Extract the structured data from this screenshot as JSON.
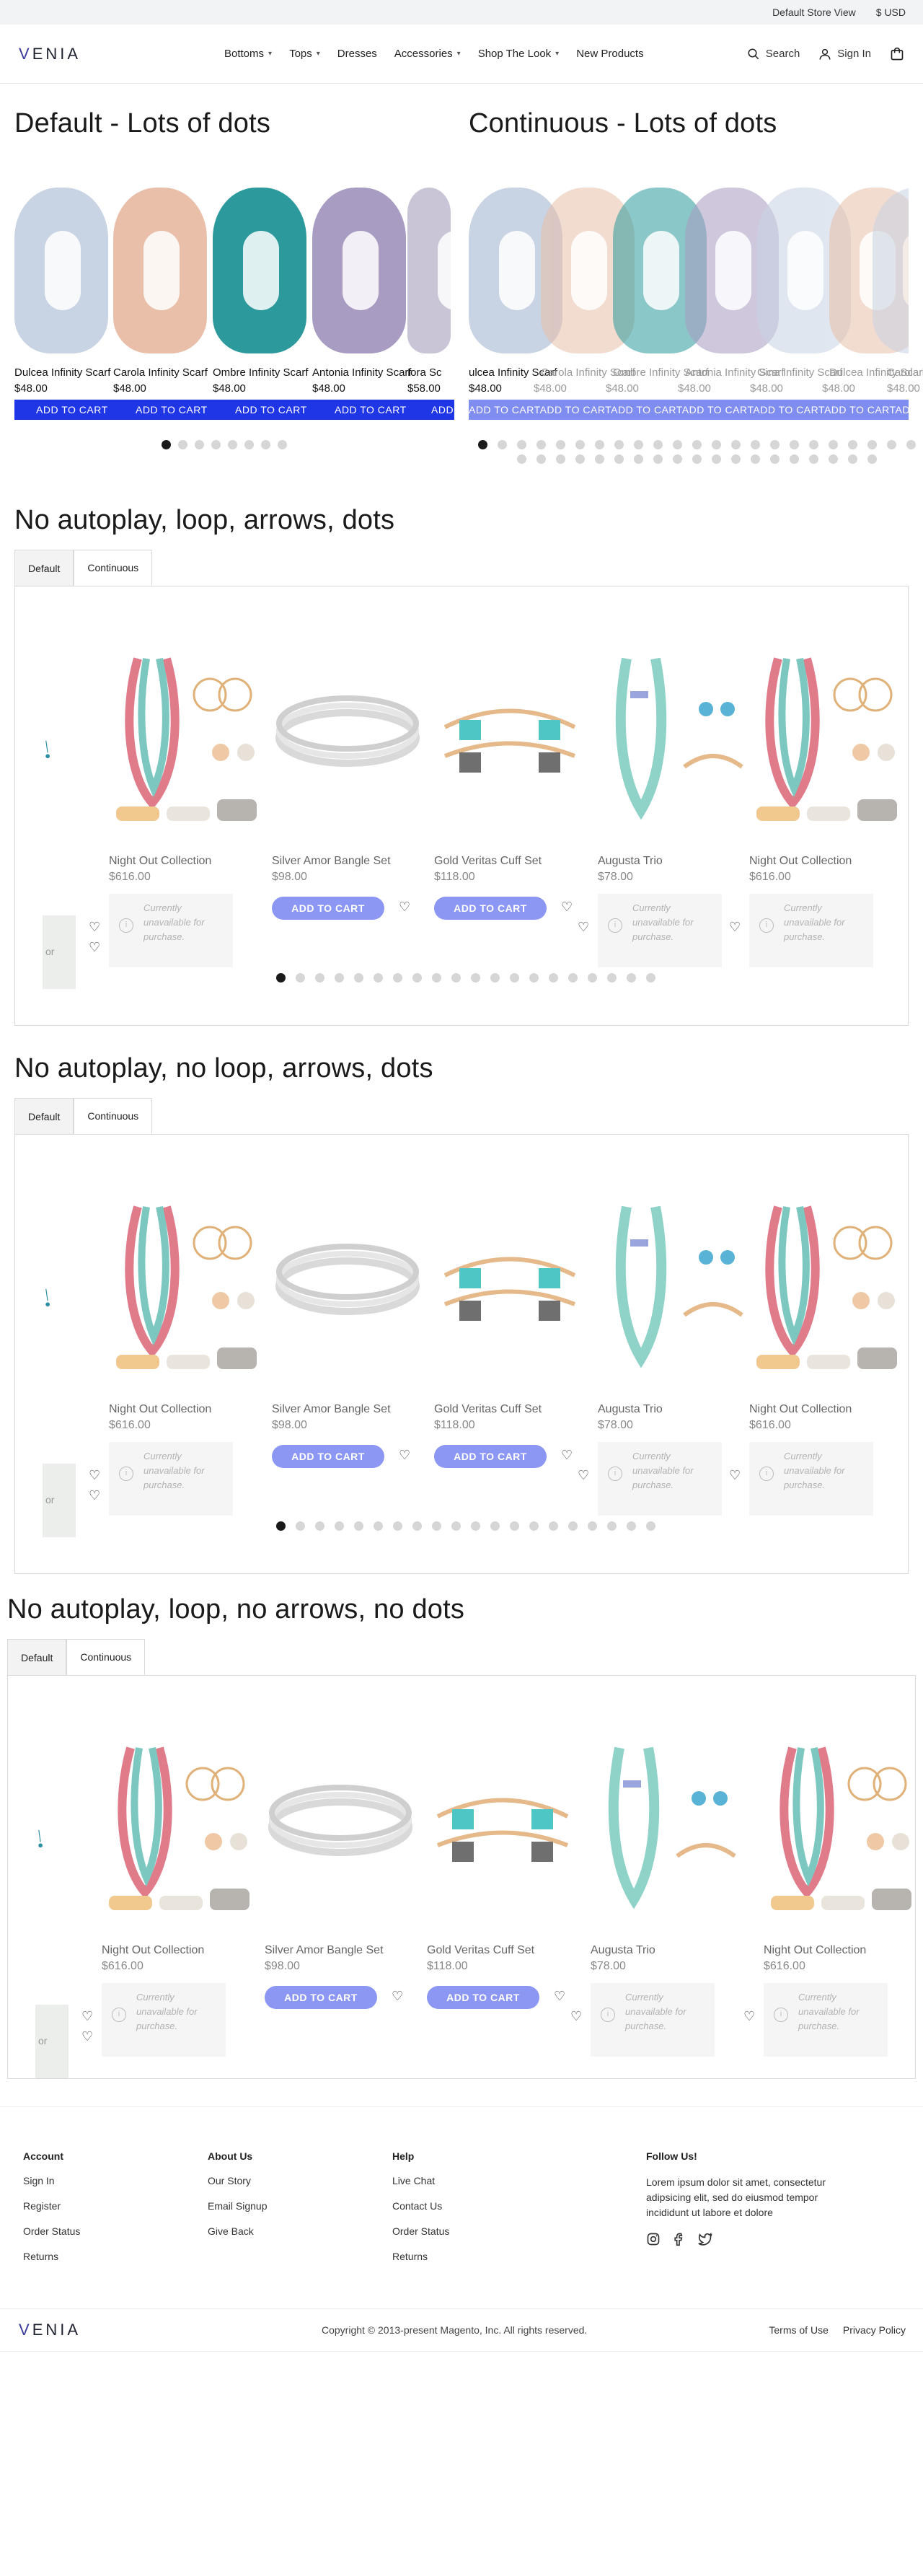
{
  "topbar": {
    "store_view": "Default Store View",
    "currency": "$ USD"
  },
  "header": {
    "logo": "VENIA",
    "nav": [
      {
        "label": "Bottoms",
        "has_menu": true
      },
      {
        "label": "Tops",
        "has_menu": true
      },
      {
        "label": "Dresses",
        "has_menu": false
      },
      {
        "label": "Accessories",
        "has_menu": true
      },
      {
        "label": "Shop The Look",
        "has_menu": true
      },
      {
        "label": "New Products",
        "has_menu": false
      }
    ],
    "search_label": "Search",
    "signin_label": "Sign In"
  },
  "lots_of_dots": {
    "default_title": "Default - Lots of dots",
    "continuous_title": "Continuous - Lots of dots",
    "default_products": [
      {
        "name": "Dulcea Infinity Scarf",
        "price": "$48.00",
        "color": "#c8d3e3"
      },
      {
        "name": "Carola Infinity Scarf",
        "price": "$48.00",
        "color": "#e9bfa9"
      },
      {
        "name": "Ombre Infinity Scarf",
        "price": "$48.00",
        "color": "#2c9a9c"
      },
      {
        "name": "Antonia Infinity Scarf",
        "price": "$48.00",
        "color": "#a99cc2"
      },
      {
        "name": "Gina Scarf",
        "price": "$58.00",
        "color": "#c9c4d6"
      }
    ],
    "default_name_cuts": [
      "Dulcea Infinity Scarf",
      "Carola Infinity Scarf",
      "Ombre Infinity Scarf",
      "Antonia Infinity Scarf",
      "Iora Sc"
    ],
    "continuous_name_cuts": [
      "ulcea Infinity Scarf",
      "Carola Infinity Scarf",
      "Ombre Infinity Scarf",
      "Antonia Infinity Scarf",
      "Gina Infinity Scarf",
      "Dulcea Infinity Scarf",
      "Carola Infinity Sc"
    ],
    "add_to_cart": "ADD TO CART",
    "continuous_add_to_cart_strip": "ADD TO CARTADD TO CARTADD TO CARTADD TO CARTADD TO CARTADD TO CARTADD TO CARTADD TO CARTADD TO CART",
    "continuous_prices": [
      "$48.00",
      "$48.00",
      "$48.00",
      "$48.00",
      "$48.00",
      "$48.00",
      "$48.00"
    ],
    "default_dots": 8,
    "continuous_dots_row1": 23,
    "continuous_dots_row2": 19
  },
  "sections": [
    {
      "title": "No autoplay, loop, arrows, dots",
      "tabs": [
        "Default",
        "Continuous"
      ],
      "active_tab": "Continuous",
      "dots": 20
    },
    {
      "title": "No autoplay, no loop, arrows, dots",
      "tabs": [
        "Default",
        "Continuous"
      ],
      "active_tab": "Continuous",
      "dots": 20
    },
    {
      "title": "No autoplay, loop, no arrows, no dots",
      "tabs": [
        "Default",
        "Continuous"
      ],
      "active_tab": "Continuous",
      "dots": 0
    }
  ],
  "jewelry": [
    {
      "name": "Night Out Collection",
      "price": "$616.00",
      "state": "unavailable"
    },
    {
      "name": "Silver Amor Bangle Set",
      "price": "$98.00",
      "state": "add"
    },
    {
      "name": "Gold Veritas Cuff Set",
      "price": "$118.00",
      "state": "add"
    },
    {
      "name": "Augusta Trio",
      "price": "$78.00",
      "state": "unavailable"
    },
    {
      "name": "Night Out Collection",
      "price": "$616.00",
      "state": "unavailable"
    }
  ],
  "jewelry_add_label": "ADD TO CART",
  "unavailable_text": "Currently unavailable for purchase.",
  "partial_left_text": "or",
  "footer": {
    "account": {
      "title": "Account",
      "links": [
        "Sign In",
        "Register",
        "Order Status",
        "Returns"
      ]
    },
    "about": {
      "title": "About Us",
      "links": [
        "Our Story",
        "Email Signup",
        "Give Back"
      ]
    },
    "help": {
      "title": "Help",
      "links": [
        "Live Chat",
        "Contact Us",
        "Order Status",
        "Returns"
      ]
    },
    "follow": {
      "title": "Follow Us!",
      "text": "Lorem ipsum dolor sit amet, consectetur adipsicing elit, sed do eiusmod tempor incididunt ut labore et dolore"
    },
    "logo": "VENIA",
    "copyright": "Copyright © 2013-present Magento, Inc. All rights reserved.",
    "terms": "Terms of Use",
    "privacy": "Privacy Policy"
  },
  "colors": {
    "add_to_cart_solid": "#1f36e6",
    "add_to_cart_soft": "#8c97f3",
    "dot_active": "#1a1a1a",
    "dot_inactive": "#d6d6d6"
  }
}
